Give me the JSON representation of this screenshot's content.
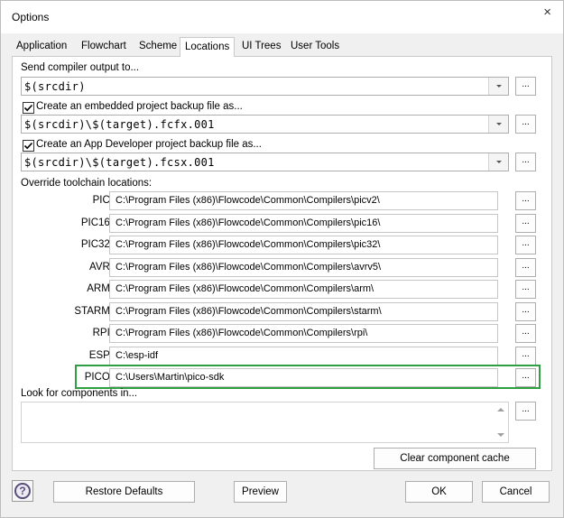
{
  "window": {
    "title": "Options"
  },
  "tabs": [
    {
      "label": "Application"
    },
    {
      "label": "Flowchart"
    },
    {
      "label": "Scheme"
    },
    {
      "label": "Locations",
      "active": true
    },
    {
      "label": "UI Trees"
    },
    {
      "label": "User Tools"
    }
  ],
  "output": {
    "label": "Send compiler output to...",
    "value": "$(srcdir)"
  },
  "embedded_backup": {
    "label": "Create an embedded project backup file as...",
    "checked": true,
    "value": "$(srcdir)\\$(target).fcfx.001"
  },
  "appdev_backup": {
    "label": "Create an App Developer project backup file as...",
    "checked": true,
    "value": "$(srcdir)\\$(target).fcsx.001"
  },
  "toolchains": {
    "heading": "Override toolchain locations:",
    "items": [
      {
        "label": "PIC:",
        "path": "C:\\Program Files (x86)\\Flowcode\\Common\\Compilers\\picv2\\"
      },
      {
        "label": "PIC16:",
        "path": "C:\\Program Files (x86)\\Flowcode\\Common\\Compilers\\pic16\\"
      },
      {
        "label": "PIC32:",
        "path": "C:\\Program Files (x86)\\Flowcode\\Common\\Compilers\\pic32\\"
      },
      {
        "label": "AVR:",
        "path": "C:\\Program Files (x86)\\Flowcode\\Common\\Compilers\\avrv5\\"
      },
      {
        "label": "ARM:",
        "path": "C:\\Program Files (x86)\\Flowcode\\Common\\Compilers\\arm\\"
      },
      {
        "label": "STARM:",
        "path": "C:\\Program Files (x86)\\Flowcode\\Common\\Compilers\\starm\\"
      },
      {
        "label": "RPI:",
        "path": "C:\\Program Files (x86)\\Flowcode\\Common\\Compilers\\rpi\\"
      },
      {
        "label": "ESP:",
        "path": "C:\\esp-idf"
      },
      {
        "label": "PICO:",
        "path": "C:\\Users\\Martin\\pico-sdk"
      }
    ]
  },
  "components": {
    "label": "Look for components in...",
    "value": ""
  },
  "buttons": {
    "browse": "...",
    "clear_cache": "Clear component cache",
    "restore_defaults": "Restore Defaults",
    "preview": "Preview",
    "ok": "OK",
    "cancel": "Cancel",
    "close": "×",
    "help": "?"
  },
  "colors": {
    "highlight": "#2ea043"
  }
}
